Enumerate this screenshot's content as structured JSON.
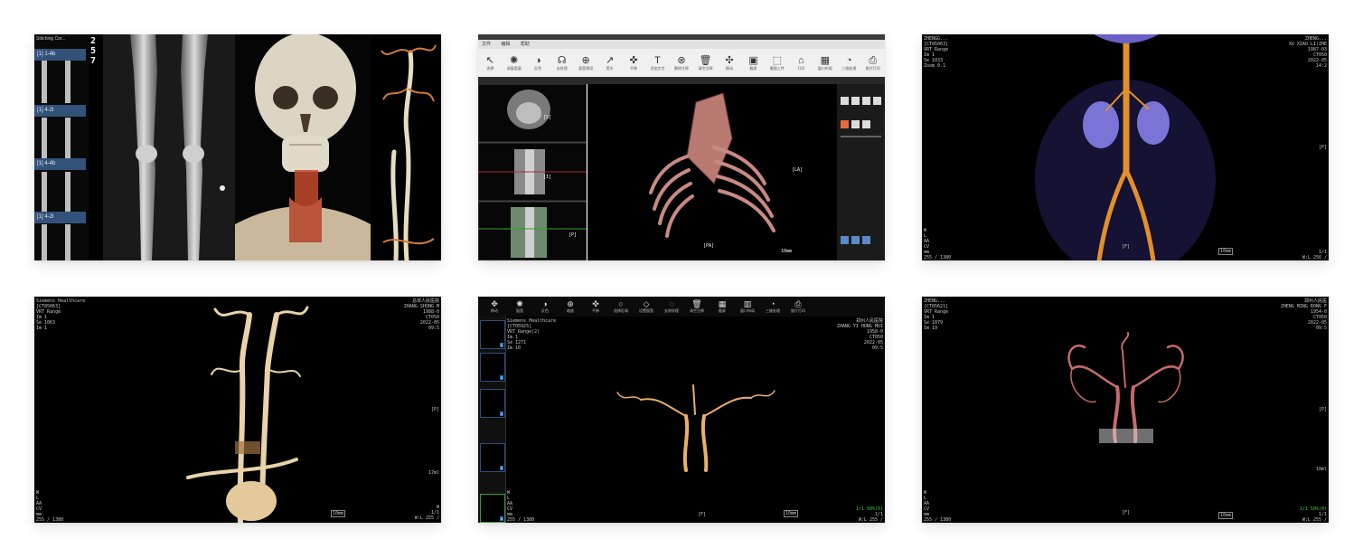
{
  "card1": {
    "side_labels": [
      "[1] 1-4b",
      "[1] 4-2l",
      "[1] 4-4b",
      "[1] 4-2l"
    ],
    "side_title": "Stitching Cor...",
    "nums": [
      "2",
      "5",
      "7"
    ]
  },
  "card2": {
    "menu": [
      "文件",
      "编辑",
      "帮助"
    ],
    "toolbar": [
      {
        "glyph": "↖",
        "label": "选择"
      },
      {
        "glyph": "✺",
        "label": "调窗宽窗"
      },
      {
        "glyph": "◑",
        "label": "反色"
      },
      {
        "glyph": "☊",
        "label": "去纹理"
      },
      {
        "glyph": "⊕",
        "label": "窗宽预设"
      },
      {
        "glyph": "↗",
        "label": "箭头"
      },
      {
        "glyph": "✜",
        "label": "平移"
      },
      {
        "glyph": "T",
        "label": "添加文字"
      },
      {
        "glyph": "⊗",
        "label": "删除注释"
      },
      {
        "glyph": "🗑",
        "label": "清空注释"
      },
      {
        "glyph": "✣",
        "label": "移动"
      },
      {
        "glyph": "▣",
        "label": "截屏"
      },
      {
        "glyph": "⬚",
        "label": "截图上传"
      },
      {
        "glyph": "⌂",
        "label": "打印"
      },
      {
        "glyph": "▦",
        "label": "窗口布局"
      },
      {
        "glyph": "◔",
        "label": "三维处理"
      },
      {
        "glyph": "⎙",
        "label": "胶片打印"
      }
    ],
    "vr_labels": {
      "left": "[LA]",
      "bottom": "[PA]",
      "scale": "10mm"
    },
    "mpr_labels": [
      "[S]",
      "[I]",
      "[P]"
    ]
  },
  "card3": {
    "left_info": "ZHENGG...\n[CT05063]\nVRT Range\nIm 1\nSe 1033\nZoom 0.1",
    "right_info": "ZHENG...\nXU XIAO LI(ZHE\n1987-03\nCT050\n2022-05\n14:2",
    "mark_p": "[P]",
    "mark_f": "[F]",
    "scale": "10mm",
    "bottom_left": "W\nL\nAA\nCV\nmm\n255 / 1380",
    "bottom_right": "1/1\nW:L 256 /"
  },
  "card4": {
    "left_info": "Siemens Healthcare\n[CT05063]\nVRT Range\nIm 1\nSe 1063\nIm 1",
    "right_info": "总体人民医院\nZHANG SHONG M\n1988-0\nCT050\n2022-05\n09:5",
    "mark_p": "[P]",
    "mark_f": "[F]",
    "scale": "10mm",
    "zoom": "17ml",
    "bottom_left": "W\nL\nAA\nCV\nmm\n255 / 1380",
    "bottom_right": "W\n1/1\nW:L 255 /"
  },
  "card5": {
    "toolbar": [
      {
        "glyph": "✥",
        "label": "移动"
      },
      {
        "glyph": "✺",
        "label": "窗宽"
      },
      {
        "glyph": "◑",
        "label": "反色"
      },
      {
        "glyph": "⊕",
        "label": "缩放"
      },
      {
        "glyph": "✜",
        "label": "平移"
      },
      {
        "glyph": "○",
        "label": "选择区域"
      },
      {
        "glyph": "◇",
        "label": "设置窗宽"
      },
      {
        "glyph": "◌",
        "label": "去除纹理"
      },
      {
        "glyph": "🗑",
        "label": "清空注释"
      },
      {
        "glyph": "▦",
        "label": "截屏"
      },
      {
        "glyph": "▥",
        "label": "窗口布局"
      },
      {
        "glyph": "◔",
        "label": "三维处理"
      },
      {
        "glyph": "⎙",
        "label": "胶片打印"
      }
    ],
    "left_info": "Siemens Healthcare\n[CT05925]\nVRT Range(2)\nIm 1\nSe 1271\nIm 10",
    "right_info": "郑州人民医院\nZHANG YI HONG MUI\n1958-0\nCT050\n2022-05\n09:5",
    "thumb_nums": [
      "1",
      "3",
      "3",
      "2",
      "3"
    ],
    "mark_f": "[F]",
    "scale": "10mm",
    "bottom_left": "W\nL\nAA\nCV\nmm\n255 / 1380",
    "bottom_right": "1/1\nW:L 255 /",
    "green": "1/1 50%(0)"
  },
  "card6": {
    "left_info": "ZHENG...\n[CT05621]\nVRT Range\nIm 1\nSe 1079\nIm 19",
    "right_info": "郑州人民医\nZHENG MING RONG F\n1954-0\nCT050\n2022-05\n09:5",
    "mark_p": "[P]",
    "mark_f": "[F]",
    "scale": "10mm",
    "zoom": "10ml",
    "bottom_left": "W\nL\nAA\nCV\nmm\n255 / 1380",
    "bottom_right": "1/1\nW:L 255 /",
    "green": "1/1 50%(0)"
  }
}
